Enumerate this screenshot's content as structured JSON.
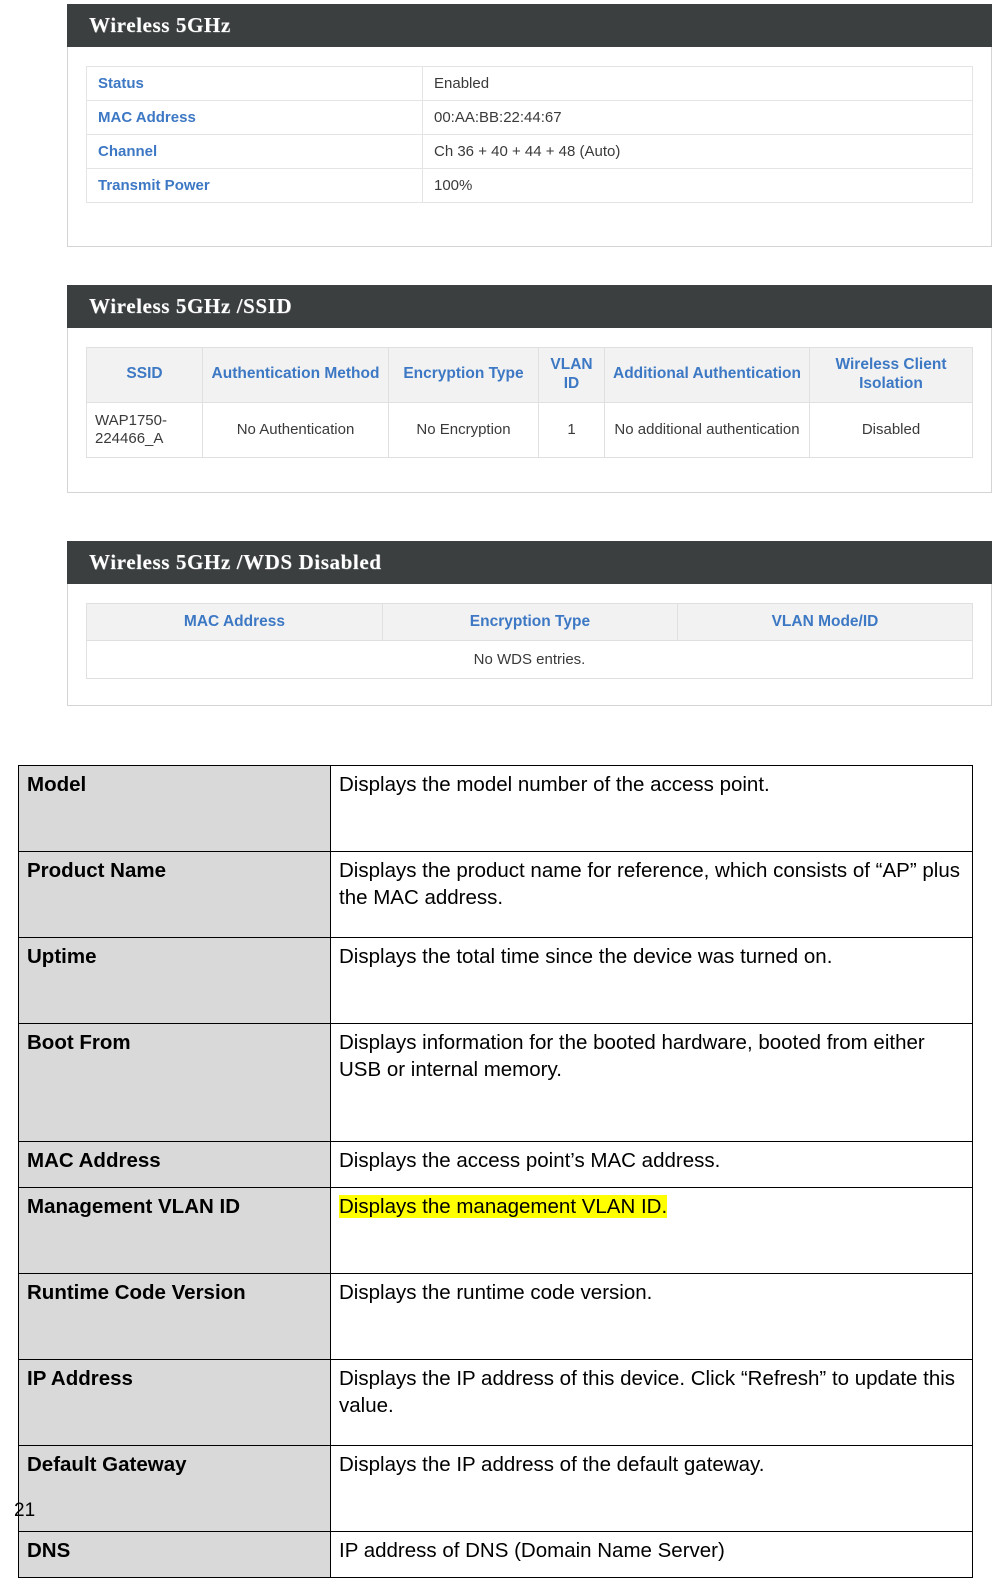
{
  "panels": [
    {
      "id": "wireless-5ghz",
      "title": "Wireless 5GHz",
      "rows": [
        {
          "label": "Status",
          "value": "Enabled"
        },
        {
          "label": "MAC Address",
          "value": "00:AA:BB:22:44:67"
        },
        {
          "label": "Channel",
          "value": "Ch 36 + 40 + 44 + 48 (Auto)"
        },
        {
          "label": "Transmit Power",
          "value": "100%"
        }
      ]
    },
    {
      "id": "wireless-5ghz-ssid",
      "title": "Wireless 5GHz /SSID",
      "headers": [
        "SSID",
        "Authentication Method",
        "Encryption Type",
        "VLAN ID",
        "Additional Authentication",
        "Wireless Client Isolation"
      ],
      "row": {
        "ssid": "WAP1750-224466_A",
        "authentication_method": "No Authentication",
        "encryption_type": "No Encryption",
        "vlan_id": "1",
        "additional_authentication": "No additional authentication",
        "wireless_client_isolation": "Disabled"
      }
    },
    {
      "id": "wireless-5ghz-wds",
      "title": "Wireless 5GHz /WDS Disabled",
      "headers": [
        "MAC Address",
        "Encryption Type",
        "VLAN Mode/ID"
      ],
      "empty_message": "No WDS entries."
    }
  ],
  "description_table": {
    "rows": [
      {
        "term": "Model",
        "desc": "Displays the model number of the access point.",
        "highlight": false
      },
      {
        "term": "Product Name",
        "desc": "Displays the product name for reference, which consists of “AP” plus the MAC address.",
        "highlight": false
      },
      {
        "term": "Uptime",
        "desc": "Displays the total time since the device was turned on.",
        "highlight": false
      },
      {
        "term": "Boot From",
        "desc": "Displays information for the booted hardware, booted from either USB or internal memory.",
        "highlight": false
      },
      {
        "term": "MAC Address",
        "desc": "Displays the access point’s MAC address.",
        "highlight": false
      },
      {
        "term": "Management VLAN ID",
        "desc": "Displays the management VLAN ID.",
        "highlight": true
      },
      {
        "term": "Runtime Code Version",
        "desc": "Displays the runtime code version.",
        "highlight": false
      },
      {
        "term": "IP Address",
        "desc": "Displays the IP address of this device. Click “Refresh” to update this value.",
        "highlight": false
      },
      {
        "term": "Default Gateway",
        "desc": "Displays the IP address of the default gateway.",
        "highlight": false
      },
      {
        "term": "DNS",
        "desc": "IP address of DNS (Domain Name Server)",
        "highlight": false
      }
    ]
  },
  "footer": {
    "page_number": "21"
  },
  "colors": {
    "panel_header_bg": "#3b3f40",
    "label_blue": "#3d78c4",
    "table_header_bg": "#f2f2f2",
    "term_cell_bg": "#d9d9d9",
    "highlight_yellow": "#ffff00"
  }
}
